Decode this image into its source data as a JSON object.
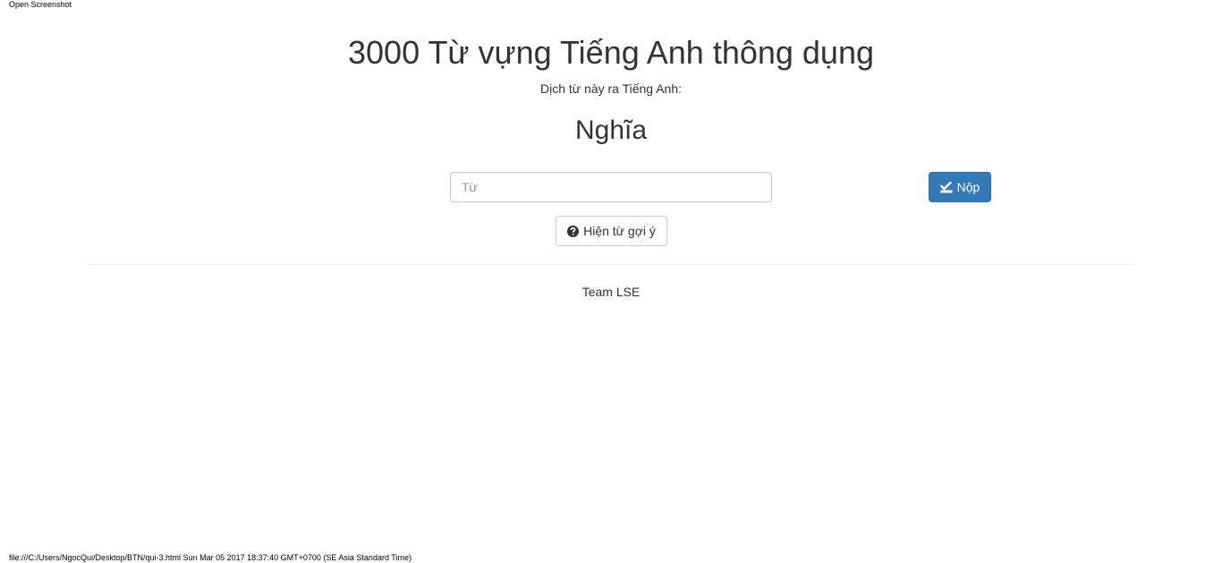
{
  "header": {
    "label": "Open Screenshot"
  },
  "main": {
    "title": "3000 Từ vựng Tiếng Anh thông dụng",
    "instruction": "Dịch từ này ra Tiếng Anh:",
    "meaning": "Nghĩa",
    "input": {
      "placeholder": "Từ",
      "value": ""
    },
    "submit": {
      "label": "Nộp",
      "icon": "check-square-icon",
      "color": "#337ab7"
    },
    "hint": {
      "label": "Hiện từ gợi ý",
      "icon": "question-circle-icon"
    }
  },
  "footer": {
    "text": "Team LSE"
  },
  "print_footer": {
    "text": "file:///C:/Users/NgocQui/Desktop/BTN/qui-3.html Sun Mar 05 2017 18:37:40 GMT+0700 (SE Asia Standard Time)"
  }
}
